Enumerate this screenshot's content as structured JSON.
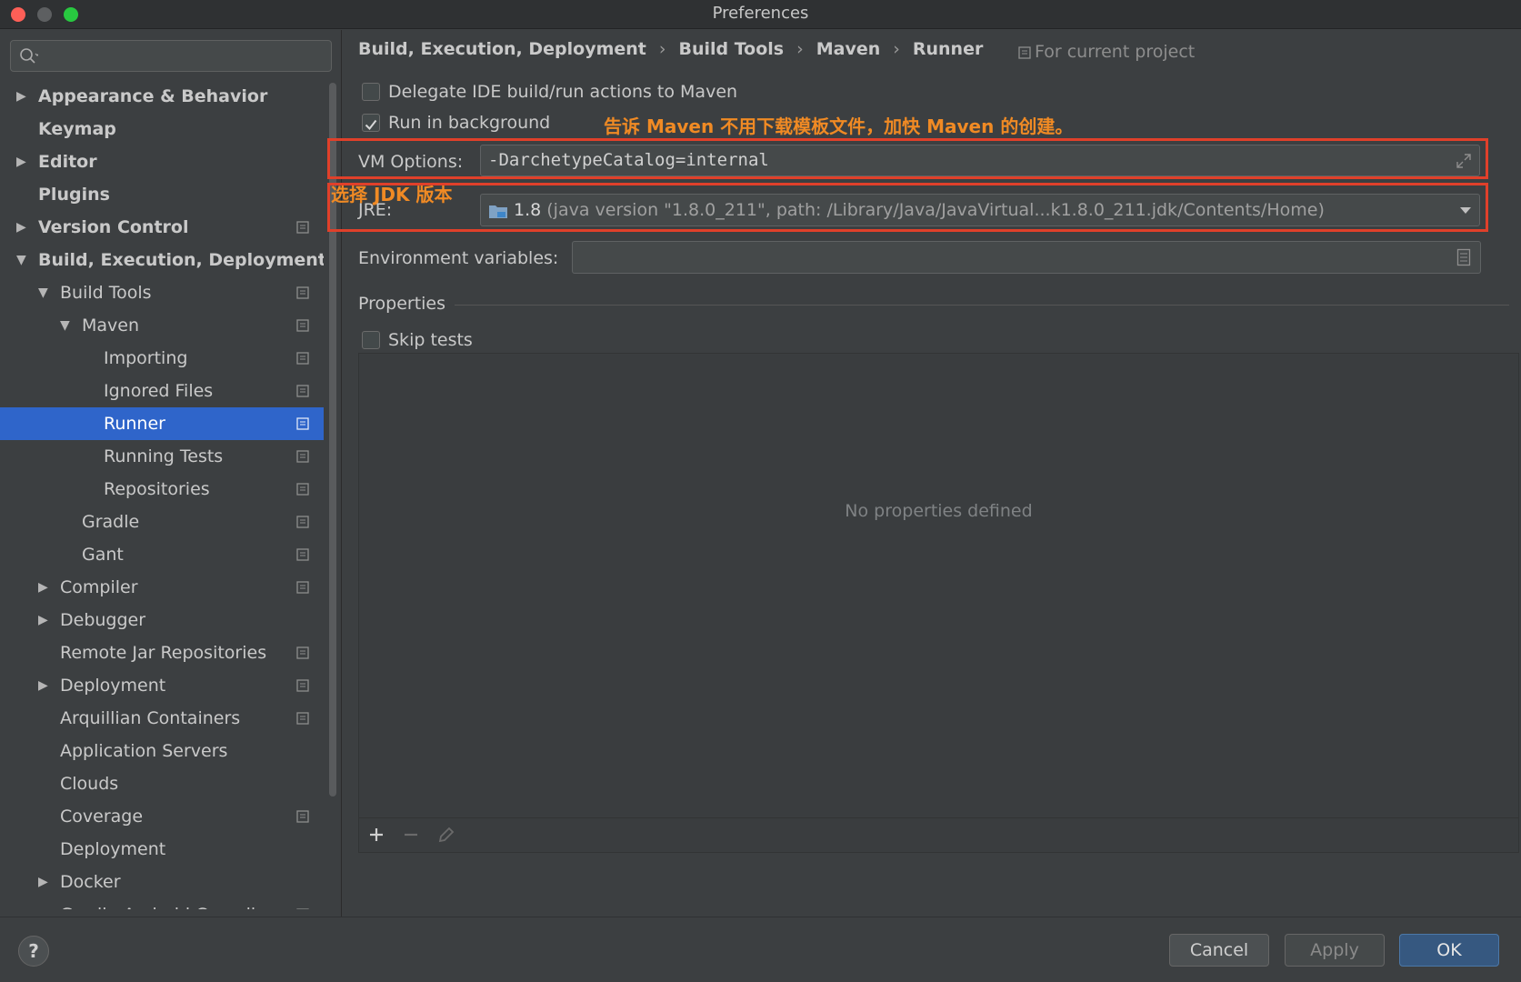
{
  "window": {
    "title": "Preferences"
  },
  "search": {
    "placeholder": ""
  },
  "tree": [
    {
      "label": "Appearance & Behavior",
      "bold": true,
      "arrow": "right",
      "level": 0,
      "proj": false,
      "selected": false
    },
    {
      "label": "Keymap",
      "bold": true,
      "arrow": "",
      "level": 0,
      "proj": false,
      "selected": false
    },
    {
      "label": "Editor",
      "bold": true,
      "arrow": "right",
      "level": 0,
      "proj": false,
      "selected": false
    },
    {
      "label": "Plugins",
      "bold": true,
      "arrow": "",
      "level": 0,
      "proj": false,
      "selected": false
    },
    {
      "label": "Version Control",
      "bold": true,
      "arrow": "right",
      "level": 0,
      "proj": true,
      "selected": false
    },
    {
      "label": "Build, Execution, Deployment",
      "bold": true,
      "arrow": "down",
      "level": 0,
      "proj": false,
      "selected": false
    },
    {
      "label": "Build Tools",
      "bold": false,
      "arrow": "down",
      "level": 1,
      "proj": true,
      "selected": false
    },
    {
      "label": "Maven",
      "bold": false,
      "arrow": "down",
      "level": 2,
      "proj": true,
      "selected": false
    },
    {
      "label": "Importing",
      "bold": false,
      "arrow": "",
      "level": 3,
      "proj": true,
      "selected": false
    },
    {
      "label": "Ignored Files",
      "bold": false,
      "arrow": "",
      "level": 3,
      "proj": true,
      "selected": false
    },
    {
      "label": "Runner",
      "bold": false,
      "arrow": "",
      "level": 3,
      "proj": true,
      "selected": true
    },
    {
      "label": "Running Tests",
      "bold": false,
      "arrow": "",
      "level": 3,
      "proj": true,
      "selected": false
    },
    {
      "label": "Repositories",
      "bold": false,
      "arrow": "",
      "level": 3,
      "proj": true,
      "selected": false
    },
    {
      "label": "Gradle",
      "bold": false,
      "arrow": "",
      "level": 2,
      "proj": true,
      "selected": false
    },
    {
      "label": "Gant",
      "bold": false,
      "arrow": "",
      "level": 2,
      "proj": true,
      "selected": false
    },
    {
      "label": "Compiler",
      "bold": false,
      "arrow": "right",
      "level": 1,
      "proj": true,
      "selected": false
    },
    {
      "label": "Debugger",
      "bold": false,
      "arrow": "right",
      "level": 1,
      "proj": false,
      "selected": false
    },
    {
      "label": "Remote Jar Repositories",
      "bold": false,
      "arrow": "",
      "level": 1,
      "proj": true,
      "selected": false
    },
    {
      "label": "Deployment",
      "bold": false,
      "arrow": "right",
      "level": 1,
      "proj": true,
      "selected": false
    },
    {
      "label": "Arquillian Containers",
      "bold": false,
      "arrow": "",
      "level": 1,
      "proj": true,
      "selected": false
    },
    {
      "label": "Application Servers",
      "bold": false,
      "arrow": "",
      "level": 1,
      "proj": false,
      "selected": false
    },
    {
      "label": "Clouds",
      "bold": false,
      "arrow": "",
      "level": 1,
      "proj": false,
      "selected": false
    },
    {
      "label": "Coverage",
      "bold": false,
      "arrow": "",
      "level": 1,
      "proj": true,
      "selected": false
    },
    {
      "label": "Deployment",
      "bold": false,
      "arrow": "",
      "level": 1,
      "proj": false,
      "selected": false
    },
    {
      "label": "Docker",
      "bold": false,
      "arrow": "right",
      "level": 1,
      "proj": false,
      "selected": false
    },
    {
      "label": "Gradle-Android Compiler",
      "bold": false,
      "arrow": "",
      "level": 1,
      "proj": true,
      "selected": false
    }
  ],
  "breadcrumb": [
    "Build, Execution, Deployment",
    "Build Tools",
    "Maven",
    "Runner"
  ],
  "breadcrumb_sep": "›",
  "for_current_project": "For current project",
  "delegate": {
    "label": "Delegate IDE build/run actions to Maven",
    "checked": false
  },
  "background": {
    "label": "Run in background",
    "checked": true
  },
  "annotation_maven": "告诉 Maven 不用下载模板文件，加快 Maven 的创建。",
  "annotation_jdk": "选择 JDK 版本",
  "vm": {
    "label": "VM Options:",
    "value": "-DarchetypeCatalog=internal"
  },
  "jre": {
    "label": "JRE:",
    "version": "1.8",
    "detail": "(java version \"1.8.0_211\", path: /Library/Java/JavaVirtual...k1.8.0_211.jdk/Contents/Home)"
  },
  "env": {
    "label": "Environment variables:",
    "value": ""
  },
  "properties": {
    "title": "Properties",
    "empty": "No properties defined"
  },
  "skip_tests": {
    "label": "Skip tests",
    "checked": false
  },
  "buttons": {
    "help": "?",
    "cancel": "Cancel",
    "apply": "Apply",
    "ok": "OK"
  },
  "colors": {
    "accent": "#2f65ca",
    "annotation": "#f08a24",
    "highlight_box": "#e0402a"
  }
}
